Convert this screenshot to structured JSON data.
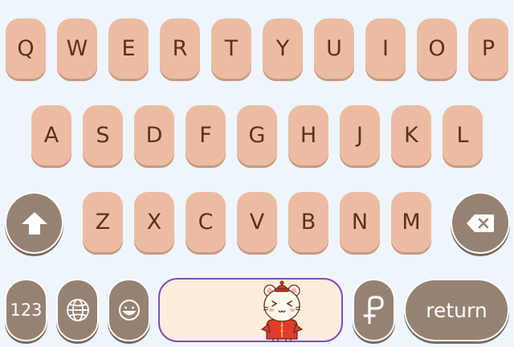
{
  "keyboard": {
    "row1": [
      "Q",
      "W",
      "E",
      "R",
      "T",
      "Y",
      "U",
      "I",
      "O",
      "P"
    ],
    "row2": [
      "A",
      "S",
      "D",
      "F",
      "G",
      "H",
      "J",
      "K",
      "L"
    ],
    "row3": [
      "Z",
      "X",
      "C",
      "V",
      "B",
      "N",
      "M"
    ],
    "numbers_label": "123",
    "return_label": "return"
  },
  "icons": {
    "shift": "shift-arrow-icon",
    "backspace": "backspace-icon",
    "globe": "globe-icon",
    "emoji": "smiley-face-icon",
    "paste": "p-clip-icon",
    "mascot": "hamster-mascot-icon"
  },
  "colors": {
    "letter_key": "#ecbca2",
    "letter_text": "#5a3217",
    "function_key": "#968273",
    "space_bar": "#fbecdc",
    "space_border": "#7f4fb7",
    "background": "#eef5fc"
  }
}
